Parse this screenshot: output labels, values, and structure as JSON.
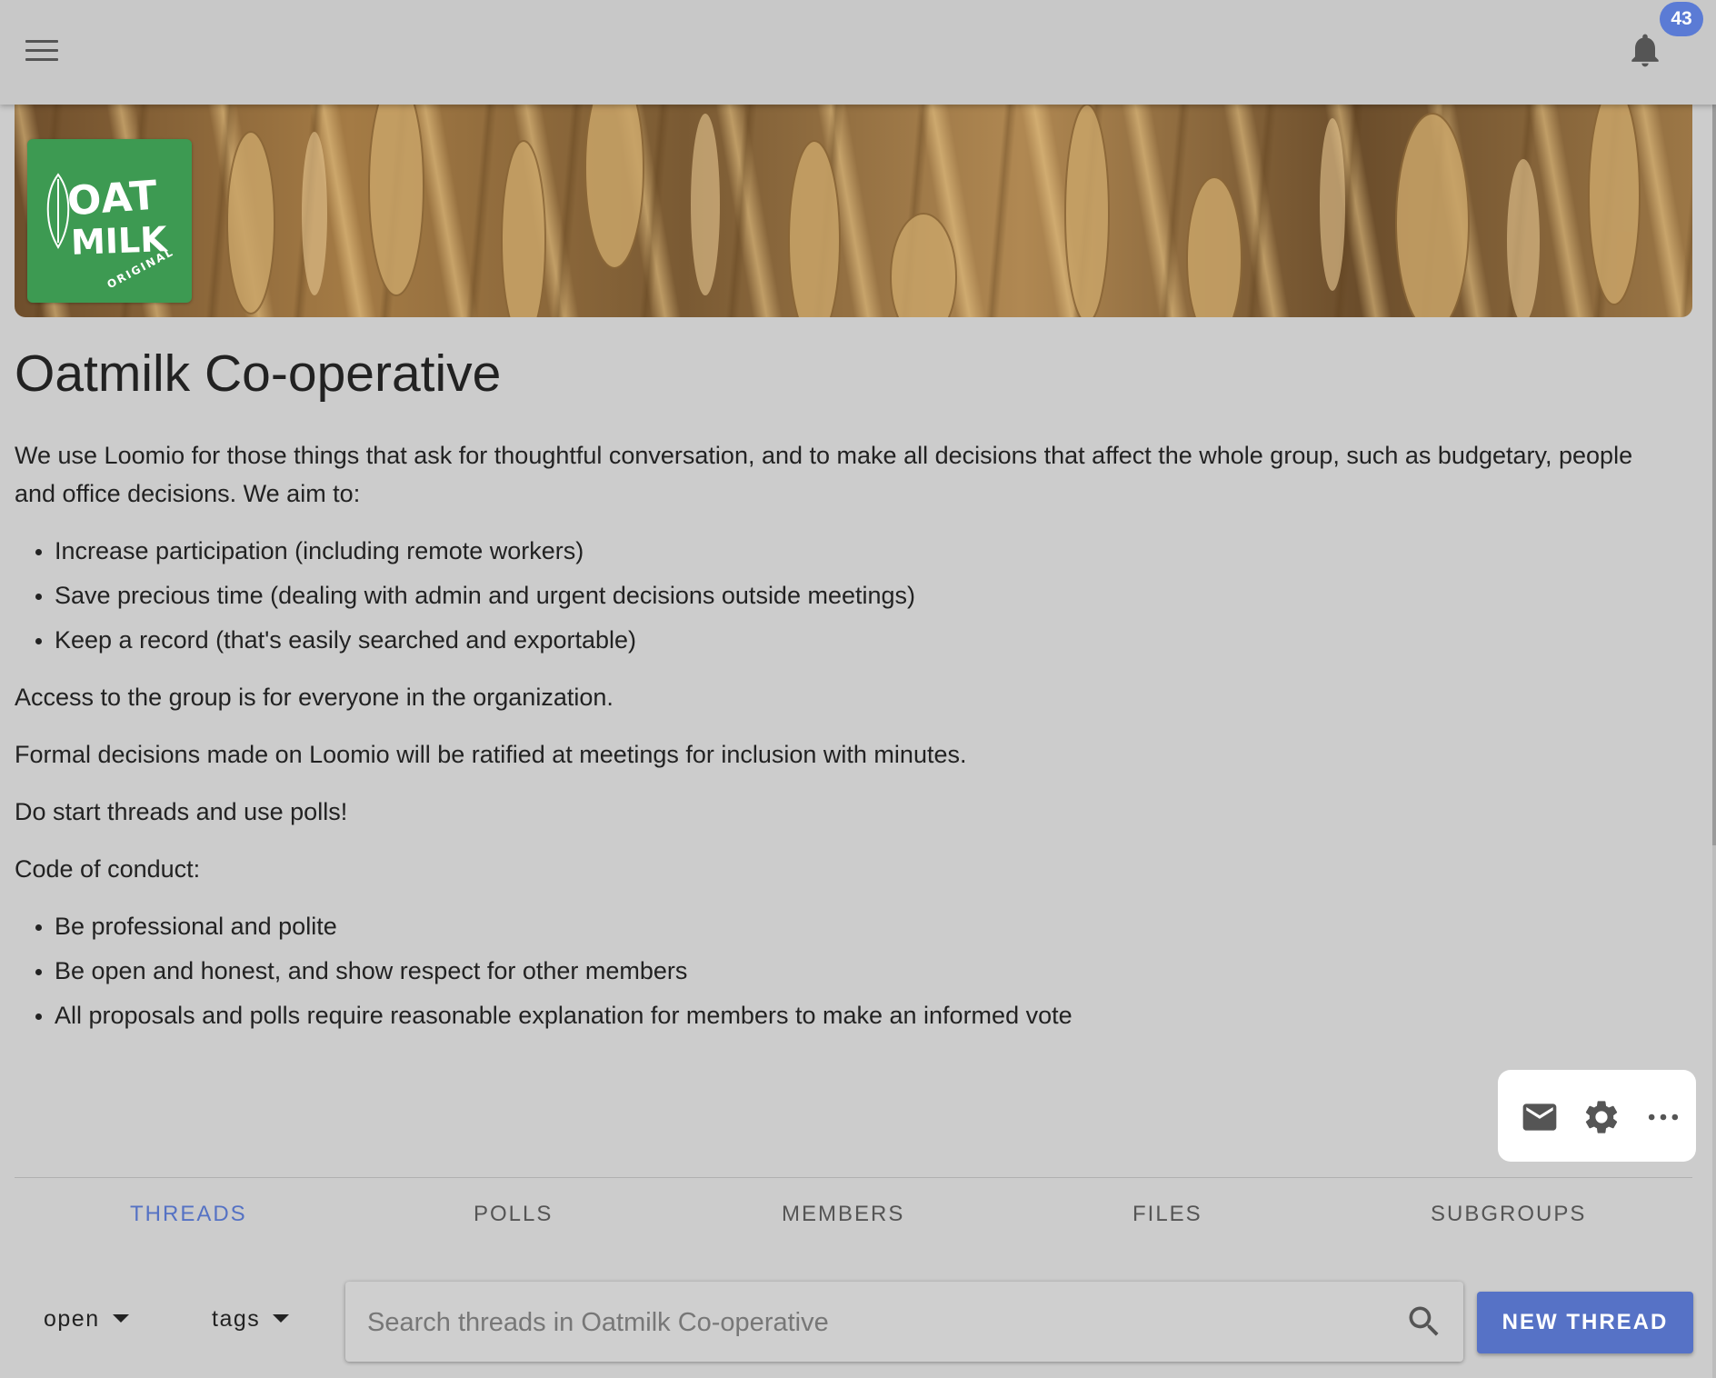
{
  "header": {
    "menu_icon": "hamburger-menu-icon",
    "bell_icon": "bell-icon",
    "notification_count": "43"
  },
  "group": {
    "logo": {
      "line1": "OAT",
      "line2": "MILK",
      "line3": "ORIGINAL",
      "color": "#3d9a52"
    },
    "name": "Oatmilk Co-operative",
    "description": {
      "intro": "We use Loomio for those things that ask for thoughtful conversation, and to make all decisions that affect the whole group, such as budgetary, people and office decisions. We aim to:",
      "aims": [
        "Increase participation (including remote workers)",
        "Save precious time (dealing with admin and urgent decisions outside meetings)",
        "Keep a record (that's easily searched and exportable)"
      ],
      "access": "Access to the group is for everyone in the organization.",
      "formal": "Formal decisions made on Loomio will be ratified at meetings for inclusion with minutes.",
      "encourage": "Do start threads and use polls!",
      "conduct_heading": "Code of conduct:",
      "conduct": [
        "Be professional and polite",
        "Be open and honest, and show respect for other members",
        "All proposals and polls require reasonable explanation for members to make an informed vote"
      ]
    }
  },
  "actions": {
    "icons": [
      "mail-icon",
      "gear-icon",
      "more-horizontal-icon"
    ]
  },
  "tabs": [
    {
      "label": "THREADS",
      "active": true
    },
    {
      "label": "POLLS",
      "active": false
    },
    {
      "label": "MEMBERS",
      "active": false
    },
    {
      "label": "FILES",
      "active": false
    },
    {
      "label": "SUBGROUPS",
      "active": false
    }
  ],
  "filters": {
    "status": "open",
    "tags": "tags"
  },
  "search": {
    "placeholder": "Search threads in Oatmilk Co-operative",
    "value": ""
  },
  "new_thread_label": "NEW THREAD",
  "colors": {
    "accent": "#5572c4",
    "badge": "#5b7bd5",
    "background": "#cccccc"
  }
}
